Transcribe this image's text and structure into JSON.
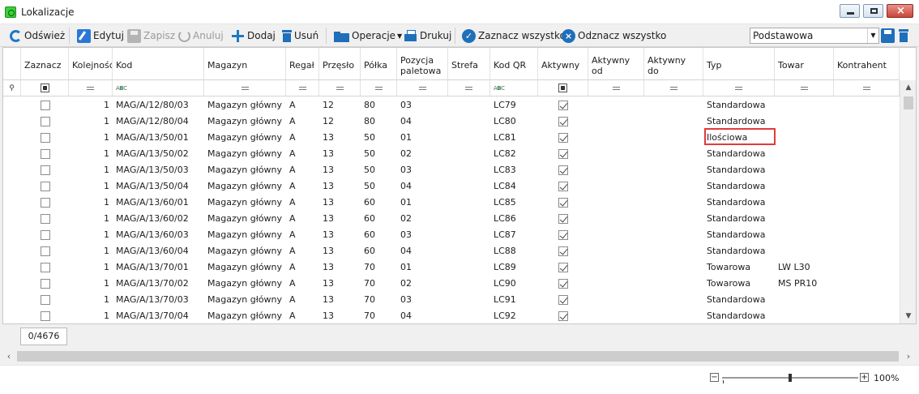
{
  "window": {
    "title": "Lokalizacje"
  },
  "toolbar": {
    "refresh": "Odśwież",
    "edit": "Edytuj",
    "save": "Zapisz",
    "cancel": "Anuluj",
    "add": "Dodaj",
    "delete": "Usuń",
    "operations": "Operacje",
    "print": "Drukuj",
    "select_all": "Zaznacz wszystko",
    "deselect_all": "Odznacz wszystko",
    "layout_value": "Podstawowa"
  },
  "columns": [
    "Zaznacz",
    "Kolejność",
    "Kod",
    "Magazyn",
    "Regał",
    "Przęsło",
    "Półka",
    "Pozycja paletowa",
    "Strefa",
    "Kod QR",
    "Aktywny",
    "Aktywny od",
    "Aktywny do",
    "Typ",
    "Towar",
    "Kontrahent"
  ],
  "rows": [
    {
      "order": "1",
      "code": "MAG/A/12/80/03",
      "warehouse": "Magazyn główny",
      "rack": "A",
      "span": "12",
      "shelf": "80",
      "pallet": "03",
      "qr": "LC79",
      "active": true,
      "type": "Standardowa",
      "item": ""
    },
    {
      "order": "1",
      "code": "MAG/A/12/80/04",
      "warehouse": "Magazyn główny",
      "rack": "A",
      "span": "12",
      "shelf": "80",
      "pallet": "04",
      "qr": "LC80",
      "active": true,
      "type": "Standardowa",
      "item": ""
    },
    {
      "order": "1",
      "code": "MAG/A/13/50/01",
      "warehouse": "Magazyn główny",
      "rack": "A",
      "span": "13",
      "shelf": "50",
      "pallet": "01",
      "qr": "LC81",
      "active": true,
      "type": "Ilościowa",
      "item": ""
    },
    {
      "order": "1",
      "code": "MAG/A/13/50/02",
      "warehouse": "Magazyn główny",
      "rack": "A",
      "span": "13",
      "shelf": "50",
      "pallet": "02",
      "qr": "LC82",
      "active": true,
      "type": "Standardowa",
      "item": ""
    },
    {
      "order": "1",
      "code": "MAG/A/13/50/03",
      "warehouse": "Magazyn główny",
      "rack": "A",
      "span": "13",
      "shelf": "50",
      "pallet": "03",
      "qr": "LC83",
      "active": true,
      "type": "Standardowa",
      "item": ""
    },
    {
      "order": "1",
      "code": "MAG/A/13/50/04",
      "warehouse": "Magazyn główny",
      "rack": "A",
      "span": "13",
      "shelf": "50",
      "pallet": "04",
      "qr": "LC84",
      "active": true,
      "type": "Standardowa",
      "item": ""
    },
    {
      "order": "1",
      "code": "MAG/A/13/60/01",
      "warehouse": "Magazyn główny",
      "rack": "A",
      "span": "13",
      "shelf": "60",
      "pallet": "01",
      "qr": "LC85",
      "active": true,
      "type": "Standardowa",
      "item": ""
    },
    {
      "order": "1",
      "code": "MAG/A/13/60/02",
      "warehouse": "Magazyn główny",
      "rack": "A",
      "span": "13",
      "shelf": "60",
      "pallet": "02",
      "qr": "LC86",
      "active": true,
      "type": "Standardowa",
      "item": ""
    },
    {
      "order": "1",
      "code": "MAG/A/13/60/03",
      "warehouse": "Magazyn główny",
      "rack": "A",
      "span": "13",
      "shelf": "60",
      "pallet": "03",
      "qr": "LC87",
      "active": true,
      "type": "Standardowa",
      "item": ""
    },
    {
      "order": "1",
      "code": "MAG/A/13/60/04",
      "warehouse": "Magazyn główny",
      "rack": "A",
      "span": "13",
      "shelf": "60",
      "pallet": "04",
      "qr": "LC88",
      "active": true,
      "type": "Standardowa",
      "item": ""
    },
    {
      "order": "1",
      "code": "MAG/A/13/70/01",
      "warehouse": "Magazyn główny",
      "rack": "A",
      "span": "13",
      "shelf": "70",
      "pallet": "01",
      "qr": "LC89",
      "active": true,
      "type": "Towarowa",
      "item": "LW L30"
    },
    {
      "order": "1",
      "code": "MAG/A/13/70/02",
      "warehouse": "Magazyn główny",
      "rack": "A",
      "span": "13",
      "shelf": "70",
      "pallet": "02",
      "qr": "LC90",
      "active": true,
      "type": "Towarowa",
      "item": "MS PR10"
    },
    {
      "order": "1",
      "code": "MAG/A/13/70/03",
      "warehouse": "Magazyn główny",
      "rack": "A",
      "span": "13",
      "shelf": "70",
      "pallet": "03",
      "qr": "LC91",
      "active": true,
      "type": "Standardowa",
      "item": ""
    },
    {
      "order": "1",
      "code": "MAG/A/13/70/04",
      "warehouse": "Magazyn główny",
      "rack": "A",
      "span": "13",
      "shelf": "70",
      "pallet": "04",
      "qr": "LC92",
      "active": true,
      "type": "Standardowa",
      "item": ""
    }
  ],
  "footer": {
    "count": "0/4676"
  },
  "zoom": {
    "label": "100%"
  },
  "colors": {
    "accent": "#1f6fba",
    "highlight": "#e23b3b"
  }
}
